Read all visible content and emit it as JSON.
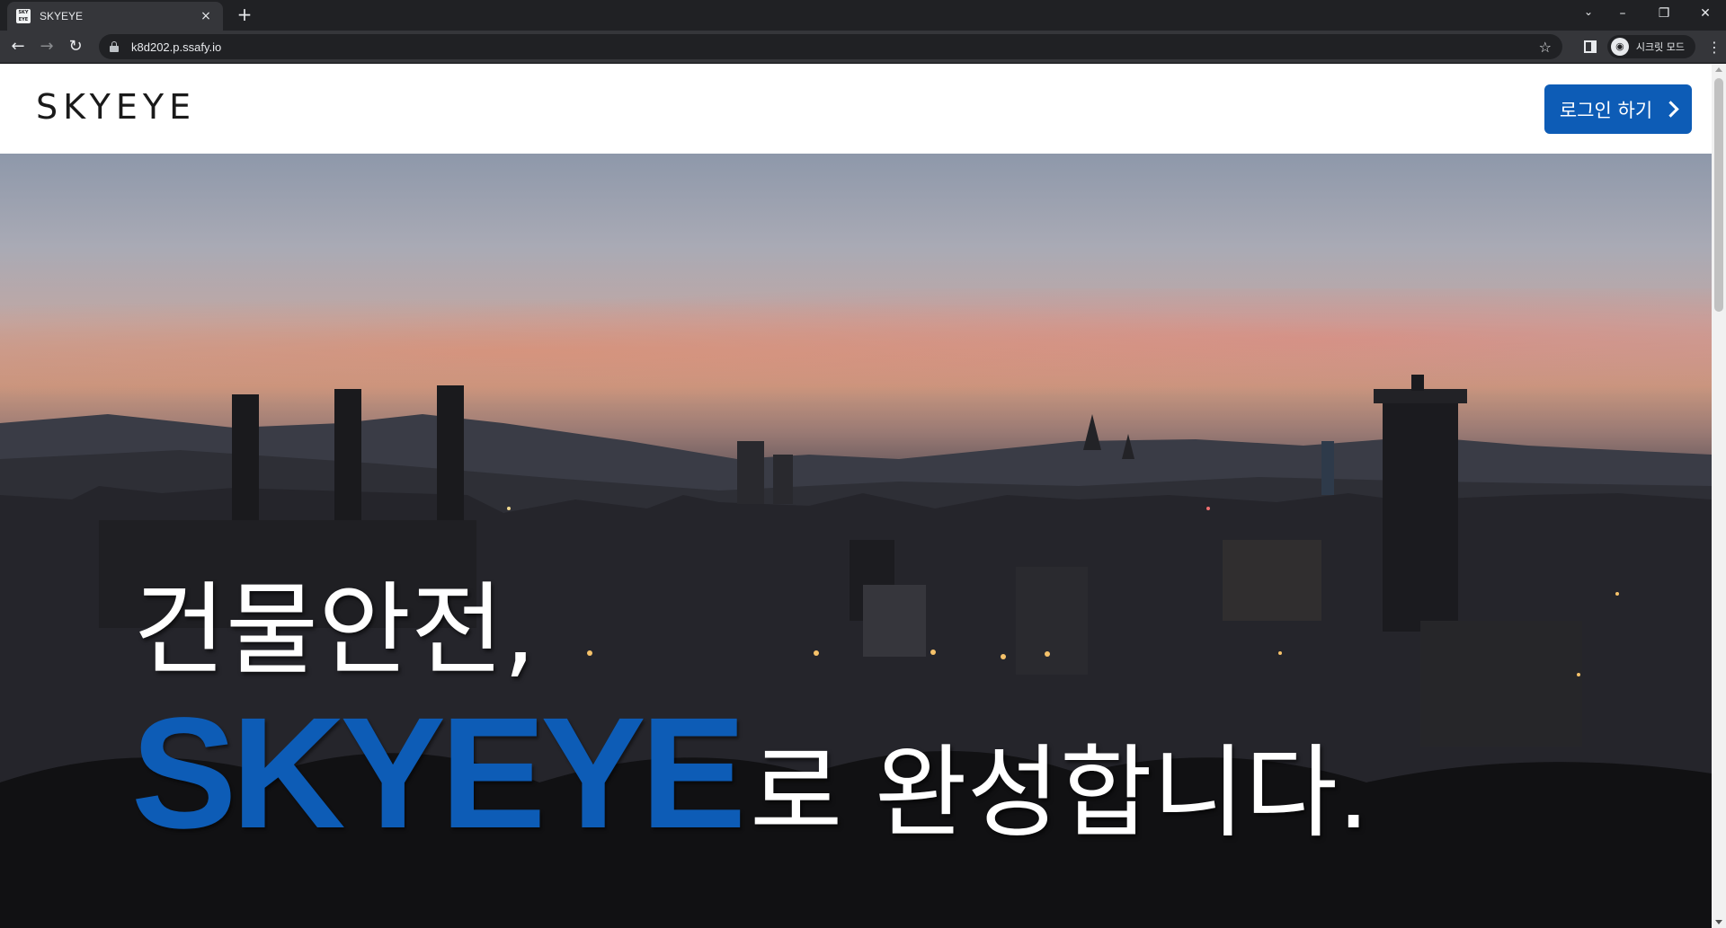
{
  "browser": {
    "tab": {
      "title": "SKYEYE",
      "favicon_text": "SKY EYE",
      "close_glyph": "×"
    },
    "new_tab_glyph": "+",
    "tab_search_glyph": "⌄",
    "window_controls": {
      "minimize": "–",
      "restore": "❐",
      "close": "✕"
    },
    "nav": {
      "back": "←",
      "forward": "→",
      "reload": "↻"
    },
    "address": "k8d202.p.ssafy.io",
    "bookmark_glyph": "☆",
    "incognito_label": "시크릿 모드",
    "incognito_glyph": "◉",
    "menu_glyph": "⋮"
  },
  "site": {
    "logo": "SKYEYE",
    "login_button_label": "로그인 하기",
    "hero": {
      "line1": "건물안전,",
      "brand": "SKYEYE",
      "line2_suffix": "로 완성합니다."
    }
  },
  "colors": {
    "brand_blue": "#0d5cb6",
    "chrome_dark": "#202124",
    "chrome_toolbar": "#35363a"
  }
}
